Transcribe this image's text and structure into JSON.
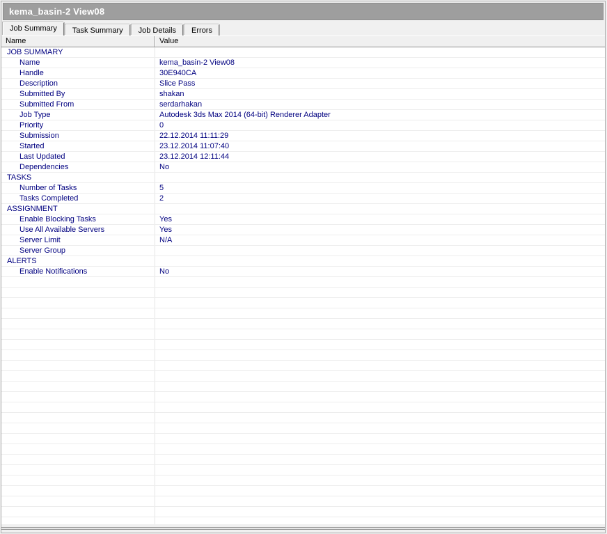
{
  "window": {
    "title": "kema_basin-2 View08"
  },
  "tabs": [
    {
      "label": "Job Summary",
      "active": true
    },
    {
      "label": "Task Summary",
      "active": false
    },
    {
      "label": "Job Details",
      "active": false
    },
    {
      "label": "Errors",
      "active": false
    }
  ],
  "table": {
    "columns": [
      "Name",
      "Value"
    ],
    "rows": [
      {
        "type": "section",
        "label": "JOB SUMMARY",
        "value": ""
      },
      {
        "type": "item",
        "label": "Name",
        "value": "kema_basin-2 View08"
      },
      {
        "type": "item",
        "label": "Handle",
        "value": "30E940CA"
      },
      {
        "type": "item",
        "label": "Description",
        "value": "Slice Pass"
      },
      {
        "type": "item",
        "label": "Submitted By",
        "value": "shakan"
      },
      {
        "type": "item",
        "label": "Submitted From",
        "value": "serdarhakan"
      },
      {
        "type": "item",
        "label": "Job Type",
        "value": "Autodesk 3ds Max 2014 (64-bit) Renderer Adapter"
      },
      {
        "type": "item",
        "label": "Priority",
        "value": "0"
      },
      {
        "type": "item",
        "label": "Submission",
        "value": "22.12.2014 11:11:29"
      },
      {
        "type": "item",
        "label": "Started",
        "value": "23.12.2014 11:07:40"
      },
      {
        "type": "item",
        "label": "Last Updated",
        "value": "23.12.2014 12:11:44"
      },
      {
        "type": "item",
        "label": "Dependencies",
        "value": "No"
      },
      {
        "type": "section",
        "label": "TASKS",
        "value": ""
      },
      {
        "type": "item",
        "label": "Number of Tasks",
        "value": "5"
      },
      {
        "type": "item",
        "label": "Tasks Completed",
        "value": "2"
      },
      {
        "type": "section",
        "label": "ASSIGNMENT",
        "value": ""
      },
      {
        "type": "item",
        "label": "Enable Blocking Tasks",
        "value": "Yes"
      },
      {
        "type": "item",
        "label": "Use All Available Servers",
        "value": "Yes"
      },
      {
        "type": "item",
        "label": "Server Limit",
        "value": "N/A"
      },
      {
        "type": "item",
        "label": "Server Group",
        "value": ""
      },
      {
        "type": "section",
        "label": "ALERTS",
        "value": ""
      },
      {
        "type": "item",
        "label": "Enable Notifications",
        "value": "No"
      }
    ],
    "empty_row_count": 24
  },
  "colors": {
    "titlebar_bg": "#9e9e9e",
    "titlebar_text": "#ffffff",
    "panel_bg": "#f0f0f0",
    "data_text": "#000080",
    "header_text": "#000000",
    "grid_line": "#ededed"
  }
}
